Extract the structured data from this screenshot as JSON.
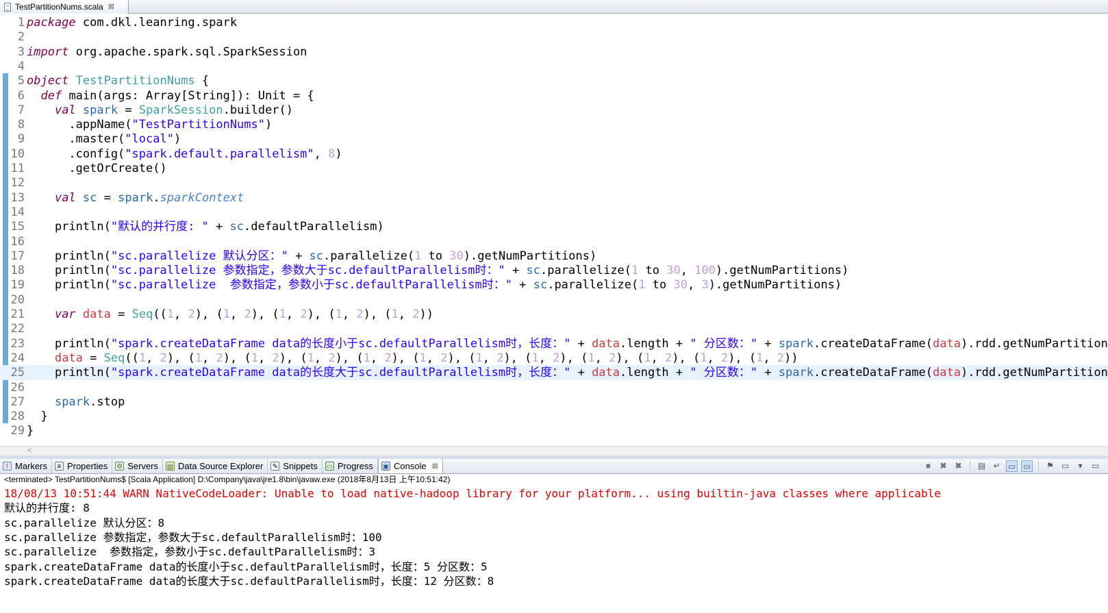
{
  "editor_tab": {
    "filename": "TestPartitionNums.scala",
    "close": "⊠"
  },
  "code_lines": [
    {
      "n": "1",
      "t": [
        [
          "kw",
          "package"
        ],
        [
          "p",
          " com.dkl.leanring.spark"
        ]
      ]
    },
    {
      "n": "2",
      "t": []
    },
    {
      "n": "3",
      "t": [
        [
          "kw",
          "import"
        ],
        [
          "p",
          " org.apache.spark.sql.SparkSession"
        ]
      ]
    },
    {
      "n": "4",
      "t": []
    },
    {
      "n": "5",
      "t": [
        [
          "kw",
          "object"
        ],
        [
          "p",
          " "
        ],
        [
          "ty",
          "TestPartitionNums"
        ],
        [
          "p",
          " {"
        ]
      ]
    },
    {
      "n": "6",
      "t": [
        [
          "p",
          "  "
        ],
        [
          "kw",
          "def"
        ],
        [
          "p",
          " main(args: Array[String]): Unit = {"
        ]
      ]
    },
    {
      "n": "7",
      "t": [
        [
          "p",
          "    "
        ],
        [
          "kw",
          "val"
        ],
        [
          "p",
          " "
        ],
        [
          "fld",
          "spark"
        ],
        [
          "p",
          " = "
        ],
        [
          "ty",
          "SparkSession"
        ],
        [
          "p",
          ".builder()"
        ]
      ]
    },
    {
      "n": "8",
      "t": [
        [
          "p",
          "      .appName("
        ],
        [
          "str",
          "\"TestPartitionNums\""
        ],
        [
          "p",
          ")"
        ]
      ]
    },
    {
      "n": "9",
      "t": [
        [
          "p",
          "      .master("
        ],
        [
          "str",
          "\"local\""
        ],
        [
          "p",
          ")"
        ]
      ]
    },
    {
      "n": "10",
      "t": [
        [
          "p",
          "      .config("
        ],
        [
          "str",
          "\"spark.default.parallelism\""
        ],
        [
          "p",
          ", "
        ],
        [
          "num",
          "8"
        ],
        [
          "p",
          ")"
        ]
      ]
    },
    {
      "n": "11",
      "t": [
        [
          "p",
          "      .getOrCreate()"
        ]
      ]
    },
    {
      "n": "12",
      "t": []
    },
    {
      "n": "13",
      "t": [
        [
          "p",
          "    "
        ],
        [
          "kw",
          "val"
        ],
        [
          "p",
          " "
        ],
        [
          "fld",
          "sc"
        ],
        [
          "p",
          " = "
        ],
        [
          "fld",
          "spark"
        ],
        [
          "p",
          "."
        ],
        [
          "fld-it",
          "sparkContext"
        ]
      ]
    },
    {
      "n": "14",
      "t": []
    },
    {
      "n": "15",
      "t": [
        [
          "p",
          "    println("
        ],
        [
          "str",
          "\"默认的并行度: \""
        ],
        [
          "p",
          " + "
        ],
        [
          "fld",
          "sc"
        ],
        [
          "p",
          ".defaultParallelism)"
        ]
      ]
    },
    {
      "n": "16",
      "t": []
    },
    {
      "n": "17",
      "t": [
        [
          "p",
          "    println("
        ],
        [
          "str",
          "\"sc.parallelize 默认分区：\""
        ],
        [
          "p",
          " + "
        ],
        [
          "fld",
          "sc"
        ],
        [
          "p",
          ".parallelize("
        ],
        [
          "num",
          "1"
        ],
        [
          "p",
          " to "
        ],
        [
          "num",
          "30"
        ],
        [
          "p",
          ").getNumPartitions)"
        ]
      ]
    },
    {
      "n": "18",
      "t": [
        [
          "p",
          "    println("
        ],
        [
          "str",
          "\"sc.parallelize 参数指定，参数大于sc.defaultParallelism时：\""
        ],
        [
          "p",
          " + "
        ],
        [
          "fld",
          "sc"
        ],
        [
          "p",
          ".parallelize("
        ],
        [
          "num",
          "1"
        ],
        [
          "p",
          " to "
        ],
        [
          "num",
          "30"
        ],
        [
          "p",
          ", "
        ],
        [
          "num",
          "100"
        ],
        [
          "p",
          ").getNumPartitions)"
        ]
      ]
    },
    {
      "n": "19",
      "t": [
        [
          "p",
          "    println("
        ],
        [
          "str",
          "\"sc.parallelize  参数指定，参数小于sc.defaultParallelism时：\""
        ],
        [
          "p",
          " + "
        ],
        [
          "fld",
          "sc"
        ],
        [
          "p",
          ".parallelize("
        ],
        [
          "num",
          "1"
        ],
        [
          "p",
          " to "
        ],
        [
          "num",
          "30"
        ],
        [
          "p",
          ", "
        ],
        [
          "num",
          "3"
        ],
        [
          "p",
          ").getNumPartitions)"
        ]
      ]
    },
    {
      "n": "20",
      "t": []
    },
    {
      "n": "21",
      "t": [
        [
          "p",
          "    "
        ],
        [
          "kw",
          "var"
        ],
        [
          "p",
          " "
        ],
        [
          "var",
          "data"
        ],
        [
          "p",
          " = "
        ],
        [
          "ty",
          "Seq"
        ],
        [
          "p",
          "(("
        ],
        [
          "num",
          "1"
        ],
        [
          "p",
          ", "
        ],
        [
          "num",
          "2"
        ],
        [
          "p",
          "), ("
        ],
        [
          "num",
          "1"
        ],
        [
          "p",
          ", "
        ],
        [
          "num",
          "2"
        ],
        [
          "p",
          "), ("
        ],
        [
          "num",
          "1"
        ],
        [
          "p",
          ", "
        ],
        [
          "num",
          "2"
        ],
        [
          "p",
          "), ("
        ],
        [
          "num",
          "1"
        ],
        [
          "p",
          ", "
        ],
        [
          "num",
          "2"
        ],
        [
          "p",
          "), ("
        ],
        [
          "num",
          "1"
        ],
        [
          "p",
          ", "
        ],
        [
          "num",
          "2"
        ],
        [
          "p",
          "))"
        ]
      ]
    },
    {
      "n": "22",
      "t": []
    },
    {
      "n": "23",
      "t": [
        [
          "p",
          "    println("
        ],
        [
          "str",
          "\"spark.createDataFrame data的长度小于sc.defaultParallelism时，长度：\""
        ],
        [
          "p",
          " + "
        ],
        [
          "var",
          "data"
        ],
        [
          "p",
          ".length + "
        ],
        [
          "str",
          "\" 分区数：\""
        ],
        [
          "p",
          " + "
        ],
        [
          "fld",
          "spark"
        ],
        [
          "p",
          ".createDataFrame("
        ],
        [
          "var",
          "data"
        ],
        [
          "p",
          ").rdd.getNumPartitions)"
        ]
      ]
    },
    {
      "n": "24",
      "t": [
        [
          "p",
          "    "
        ],
        [
          "var",
          "data"
        ],
        [
          "p",
          " = "
        ],
        [
          "ty",
          "Seq"
        ],
        [
          "p",
          "(("
        ],
        [
          "num",
          "1"
        ],
        [
          "p",
          ", "
        ],
        [
          "num",
          "2"
        ],
        [
          "p",
          "), ("
        ],
        [
          "num",
          "1"
        ],
        [
          "p",
          ", "
        ],
        [
          "num",
          "2"
        ],
        [
          "p",
          "), ("
        ],
        [
          "num",
          "1"
        ],
        [
          "p",
          ", "
        ],
        [
          "num",
          "2"
        ],
        [
          "p",
          "), ("
        ],
        [
          "num",
          "1"
        ],
        [
          "p",
          ", "
        ],
        [
          "num",
          "2"
        ],
        [
          "p",
          "), ("
        ],
        [
          "num",
          "1"
        ],
        [
          "p",
          ", "
        ],
        [
          "num",
          "2"
        ],
        [
          "p",
          "), ("
        ],
        [
          "num",
          "1"
        ],
        [
          "p",
          ", "
        ],
        [
          "num",
          "2"
        ],
        [
          "p",
          "), ("
        ],
        [
          "num",
          "1"
        ],
        [
          "p",
          ", "
        ],
        [
          "num",
          "2"
        ],
        [
          "p",
          "), ("
        ],
        [
          "num",
          "1"
        ],
        [
          "p",
          ", "
        ],
        [
          "num",
          "2"
        ],
        [
          "p",
          "), ("
        ],
        [
          "num",
          "1"
        ],
        [
          "p",
          ", "
        ],
        [
          "num",
          "2"
        ],
        [
          "p",
          "), ("
        ],
        [
          "num",
          "1"
        ],
        [
          "p",
          ", "
        ],
        [
          "num",
          "2"
        ],
        [
          "p",
          "), ("
        ],
        [
          "num",
          "1"
        ],
        [
          "p",
          ", "
        ],
        [
          "num",
          "2"
        ],
        [
          "p",
          "), ("
        ],
        [
          "num",
          "1"
        ],
        [
          "p",
          ", "
        ],
        [
          "num",
          "2"
        ],
        [
          "p",
          "))"
        ]
      ]
    },
    {
      "n": "25",
      "t": [
        [
          "p",
          "    println("
        ],
        [
          "str",
          "\"spark.createDataFrame data的长度大于sc.defaultParallelism时，长度：\""
        ],
        [
          "p",
          " + "
        ],
        [
          "var",
          "data"
        ],
        [
          "p",
          ".length + "
        ],
        [
          "str",
          "\" 分区数：\""
        ],
        [
          "p",
          " + "
        ],
        [
          "fld",
          "spark"
        ],
        [
          "p",
          ".createDataFrame("
        ],
        [
          "var",
          "data"
        ],
        [
          "p",
          ").rdd.getNumPartitions)"
        ]
      ]
    },
    {
      "n": "26",
      "t": []
    },
    {
      "n": "27",
      "t": [
        [
          "p",
          "    "
        ],
        [
          "fld",
          "spark"
        ],
        [
          "p",
          ".stop"
        ]
      ]
    },
    {
      "n": "28",
      "t": [
        [
          "p",
          "  }"
        ]
      ]
    },
    {
      "n": "29",
      "t": [
        [
          "p",
          "}"
        ]
      ]
    }
  ],
  "current_line": "25",
  "views_tabs": [
    {
      "label": "Markers",
      "icon": "markers-icon",
      "glyph": "!"
    },
    {
      "label": "Properties",
      "icon": "properties-icon",
      "glyph": "≡"
    },
    {
      "label": "Servers",
      "icon": "servers-icon",
      "glyph": "⚙"
    },
    {
      "label": "Data Source Explorer",
      "icon": "data-source-explorer-icon",
      "glyph": "▤"
    },
    {
      "label": "Snippets",
      "icon": "snippets-icon",
      "glyph": "✎"
    },
    {
      "label": "Progress",
      "icon": "progress-icon",
      "glyph": "▭"
    },
    {
      "label": "Console",
      "icon": "console-icon",
      "glyph": "▣",
      "active": true,
      "close": "⊠"
    }
  ],
  "toolbar_buttons": [
    {
      "name": "terminate-icon",
      "glyph": "■"
    },
    {
      "name": "remove-launch-icon",
      "glyph": "✖"
    },
    {
      "name": "remove-all-terminated-icon",
      "glyph": "✖"
    },
    {
      "name": "scroll-lock-icon",
      "glyph": "▤"
    },
    {
      "name": "word-wrap-icon",
      "glyph": "↵"
    },
    {
      "name": "show-stdout-icon",
      "glyph": "▭",
      "sel": true
    },
    {
      "name": "show-stderr-icon",
      "glyph": "▭",
      "sel": true
    },
    {
      "name": "pin-console-icon",
      "glyph": "⚑"
    },
    {
      "name": "display-selected-console-icon",
      "glyph": "▭"
    },
    {
      "name": "dropdown-icon",
      "glyph": "▾"
    },
    {
      "name": "open-console-icon",
      "glyph": "▭"
    }
  ],
  "console": {
    "description": "<terminated> TestPartitionNums$ [Scala Application] D:\\Company\\java\\jre1.8\\bin\\javaw.exe (2018年8月13日 上午10:51:42)",
    "lines": [
      {
        "text": "18/08/13 10:51:44 WARN NativeCodeLoader: Unable to load native-hadoop library for your platform... using builtin-java classes where applicable",
        "err": true
      },
      {
        "text": "默认的并行度: 8",
        "err": false
      },
      {
        "text": "sc.parallelize 默认分区：8",
        "err": false
      },
      {
        "text": "sc.parallelize 参数指定，参数大于sc.defaultParallelism时：100",
        "err": false
      },
      {
        "text": "sc.parallelize  参数指定，参数小于sc.defaultParallelism时：3",
        "err": false
      },
      {
        "text": "spark.createDataFrame data的长度小于sc.defaultParallelism时，长度：5 分区数：5",
        "err": false
      },
      {
        "text": "spark.createDataFrame data的长度大于sc.defaultParallelism时，长度：12 分区数：8",
        "err": false
      }
    ]
  },
  "colors": {
    "keyword": "#7f0055",
    "type": "#3f9f9f",
    "string": "#2a00ff",
    "number": "#c59dd8",
    "field": "#2a68a6",
    "local_var": "#d0383f",
    "console_error": "#e00000",
    "current_line": "#e8f2fe"
  }
}
